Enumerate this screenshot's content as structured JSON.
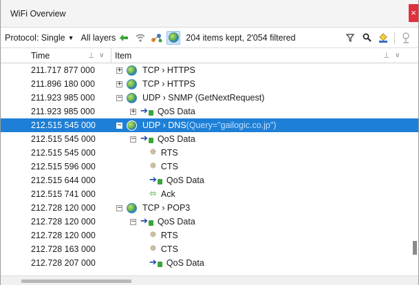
{
  "window": {
    "title": "WiFi Overview",
    "close_glyph": "×"
  },
  "toolbar": {
    "protocol_label": "Protocol: Single",
    "layers_label": "All layers",
    "summary": "204 items kept, 2'054 filtered",
    "icons": [
      "back-arrow-icon",
      "wifi-icon",
      "nodes-icon",
      "globe-icon",
      "filter-icon",
      "search-icon",
      "paint-icon",
      "network-icon"
    ],
    "accent": "#1e7fd6"
  },
  "columns": {
    "time": "Time",
    "item": "Item",
    "pin_glyph": "⊥"
  },
  "rows": [
    {
      "time": "211.717 877 000",
      "indent": 0,
      "icon": "globe",
      "expander": "+",
      "label": "TCP › HTTPS"
    },
    {
      "time": "211.896 180 000",
      "indent": 0,
      "icon": "globe",
      "expander": "+",
      "label": "TCP › HTTPS"
    },
    {
      "time": "211.923 985 000",
      "indent": 0,
      "icon": "globe",
      "expander": "−",
      "label": "UDP › SNMP (GetNextRequest)"
    },
    {
      "time": "211.923 985 000",
      "indent": 1,
      "icon": "arrow-lock",
      "expander": "+",
      "label": "QoS Data"
    },
    {
      "time": "212.515 545 000",
      "indent": 0,
      "icon": "globe",
      "expander": "−",
      "label": "UDP › DNS ",
      "query": "(Query=\"gailogic.co.jp\")",
      "selected": true
    },
    {
      "time": "212.515 545 000",
      "indent": 1,
      "icon": "arrow-lock",
      "expander": "−",
      "label": "QoS Data"
    },
    {
      "time": "212.515 545 000",
      "indent": 2,
      "icon": "star",
      "label": "RTS"
    },
    {
      "time": "212.515 596 000",
      "indent": 2,
      "icon": "star",
      "label": "CTS"
    },
    {
      "time": "212.515 644 000",
      "indent": 2,
      "icon": "arrow-lock",
      "label": "QoS Data"
    },
    {
      "time": "212.515 741 000",
      "indent": 2,
      "icon": "ack",
      "label": "Ack"
    },
    {
      "time": "212.728 120 000",
      "indent": 0,
      "icon": "globe",
      "expander": "−",
      "label": "TCP › POP3"
    },
    {
      "time": "212.728 120 000",
      "indent": 1,
      "icon": "arrow-lock",
      "expander": "−",
      "label": "QoS Data"
    },
    {
      "time": "212.728 120 000",
      "indent": 2,
      "icon": "star",
      "label": "RTS"
    },
    {
      "time": "212.728 163 000",
      "indent": 2,
      "icon": "star",
      "label": "CTS"
    },
    {
      "time": "212.728 207 000",
      "indent": 2,
      "icon": "arrow-lock",
      "label": "QoS Data"
    }
  ]
}
